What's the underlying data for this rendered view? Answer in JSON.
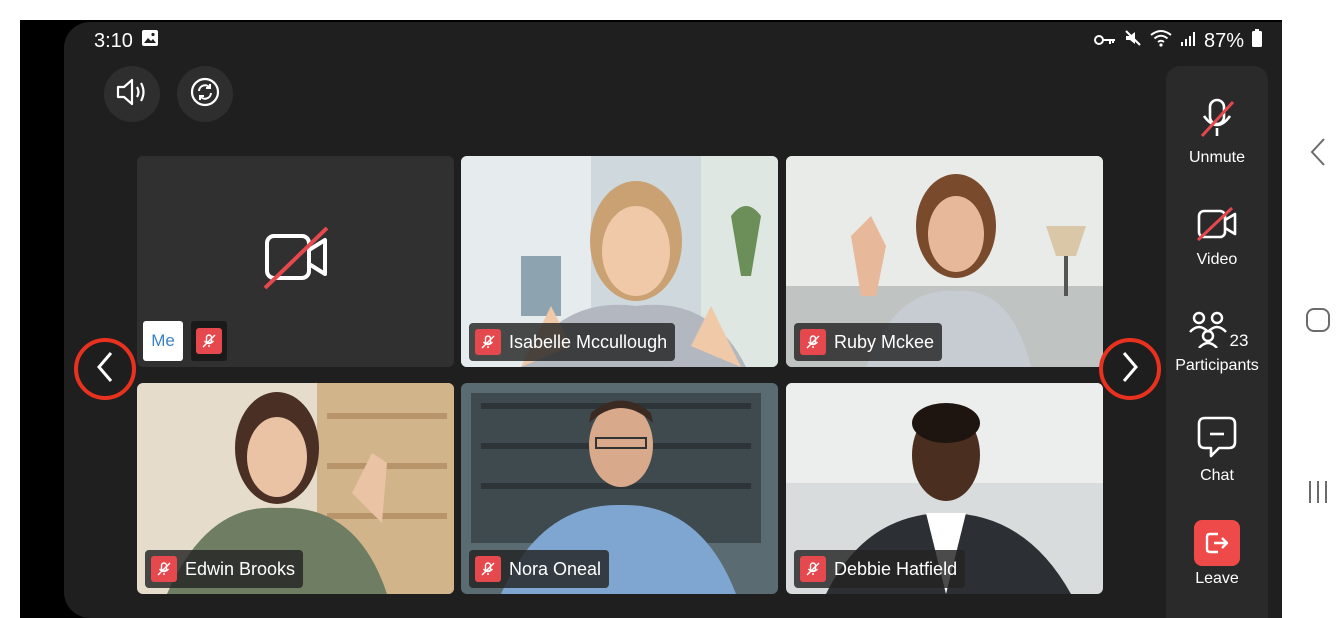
{
  "status_bar": {
    "time": "3:10",
    "battery": "87%"
  },
  "top_controls": {
    "speaker_icon": "speaker-icon",
    "switch_camera_icon": "switch-camera-icon"
  },
  "self_tile": {
    "me_label": "Me",
    "camera_state": "video-off"
  },
  "participants": [
    {
      "name": "Isabelle Mccullough",
      "muted": true
    },
    {
      "name": "Ruby Mckee",
      "muted": true
    },
    {
      "name": "Edwin Brooks",
      "muted": true
    },
    {
      "name": "Nora Oneal",
      "muted": true
    },
    {
      "name": "Debbie Hatfield",
      "muted": true
    }
  ],
  "side_panel": {
    "unmute_label": "Unmute",
    "video_label": "Video",
    "participants_label": "Participants",
    "participants_count": "23",
    "chat_label": "Chat",
    "leave_label": "Leave"
  },
  "colors": {
    "accent_red": "#e5484d",
    "highlight_ring": "#e8321f",
    "leave_red": "#ef4a4a",
    "panel_bg": "#2a2a2a"
  }
}
